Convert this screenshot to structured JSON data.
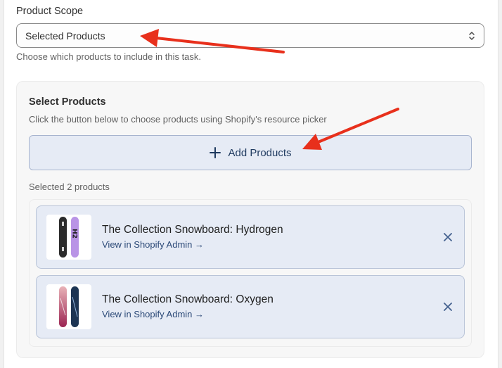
{
  "scope": {
    "label": "Product Scope",
    "selected_value": "Selected Products",
    "help_text": "Choose which products to include in this task."
  },
  "selector": {
    "title": "Select Products",
    "description": "Click the button below to choose products using Shopify's resource picker",
    "add_button_label": "Add Products",
    "selected_count_text": "Selected 2 products"
  },
  "products": [
    {
      "title": "The Collection Snowboard: Hydrogen",
      "link": "View in Shopify Admin →"
    },
    {
      "title": "The Collection Snowboard: Oxygen",
      "link": "View in Shopify Admin →"
    }
  ],
  "colors": {
    "annotation_arrow": "#e8301c",
    "accent": "#1f3a5f"
  },
  "icons": [
    "chevron-updown-icon",
    "plus-icon",
    "close-icon"
  ]
}
